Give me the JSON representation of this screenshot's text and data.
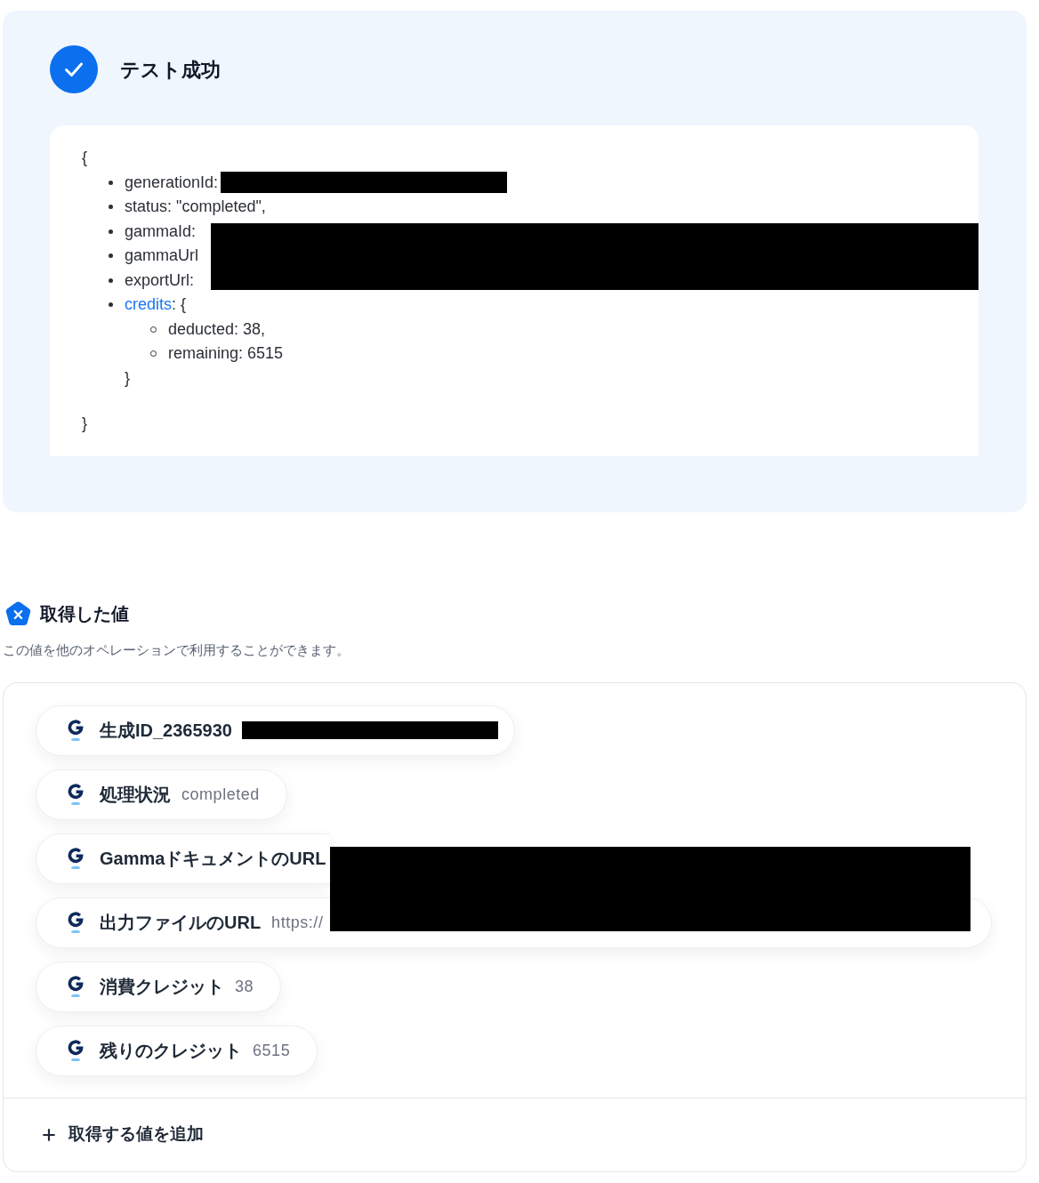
{
  "result": {
    "title": "テスト成功",
    "output": {
      "open": "{",
      "items": [
        {
          "kind": "masked",
          "text": "generationId:"
        },
        {
          "kind": "plain",
          "text": "status: \"completed\","
        },
        {
          "kind": "covered",
          "text": "gammaId:"
        },
        {
          "kind": "covered",
          "text": "gammaUrl"
        },
        {
          "kind": "covered",
          "text": "exportUrl:"
        },
        {
          "kind": "object",
          "key": "credits",
          "text": ": {",
          "children": [
            {
              "text": "deducted: 38,"
            },
            {
              "text": "remaining: 6515"
            }
          ],
          "close": "}"
        }
      ],
      "close": "}"
    }
  },
  "acquired_values": {
    "title": "取得した値",
    "description": "この値を他のオペレーションで利用することができます。",
    "items": [
      {
        "kind": "masked",
        "label": "生成ID_2365930"
      },
      {
        "kind": "plain",
        "label": "処理状況",
        "value": "completed"
      },
      {
        "kind": "covered",
        "label": "GammaドキュメントのURL"
      },
      {
        "kind": "covered",
        "label": "出力ファイルのURL",
        "value": "https://"
      },
      {
        "kind": "plain",
        "label": "消費クレジット",
        "value": "38"
      },
      {
        "kind": "plain",
        "label": "残りのクレジット",
        "value": "6515"
      }
    ],
    "add_button": "取得する値を追加"
  }
}
